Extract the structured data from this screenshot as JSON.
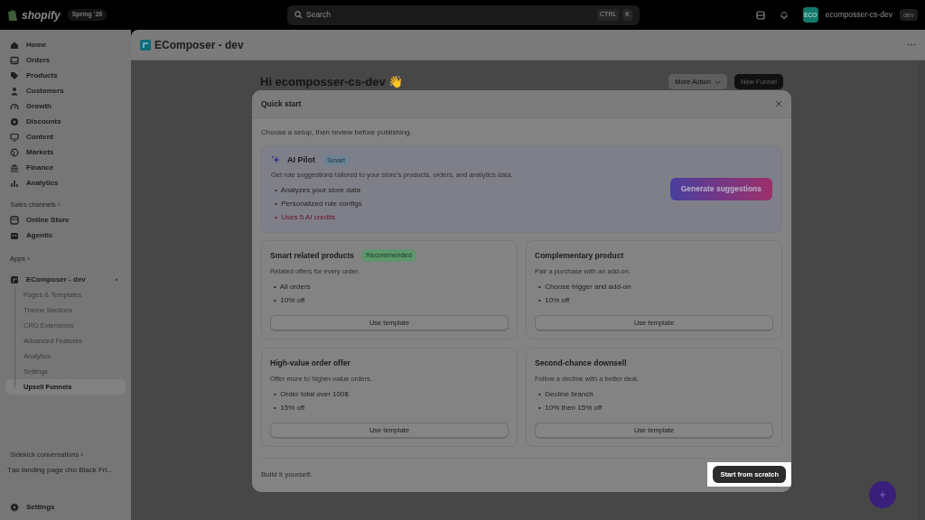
{
  "top_bar": {
    "brand": "shopify",
    "edition": "Spring '26",
    "search": {
      "placeholder": "Search",
      "shortcut": [
        "CTRL",
        "K"
      ]
    },
    "store": {
      "avatar": "ECO",
      "name": "ecomposser-cs-dev",
      "badge": "dev"
    }
  },
  "sidebar": {
    "nav": [
      {
        "label": "Home",
        "selected": false
      },
      {
        "label": "Orders",
        "selected": false
      },
      {
        "label": "Products",
        "selected": false
      },
      {
        "label": "Customers",
        "selected": false
      },
      {
        "label": "Growth",
        "selected": false
      },
      {
        "label": "Discounts",
        "selected": false
      },
      {
        "label": "Content",
        "selected": false
      },
      {
        "label": "Markets",
        "selected": false
      },
      {
        "label": "Finance",
        "selected": false
      },
      {
        "label": "Analytics",
        "selected": false
      }
    ],
    "sales_channels": {
      "title": "Sales channels ›",
      "items": [
        {
          "label": "Online Store",
          "selected": false
        },
        {
          "label": "Agentic",
          "selected": false
        }
      ]
    },
    "apps": {
      "title": "Apps ›",
      "app": {
        "label": "EComposer - dev",
        "children": [
          {
            "label": "Pages & Templates",
            "selected": false
          },
          {
            "label": "Theme Sections",
            "selected": false
          },
          {
            "label": "CRO Extensions",
            "selected": false
          },
          {
            "label": "Advanced Features",
            "selected": false
          },
          {
            "label": "Analytics",
            "selected": false
          },
          {
            "label": "Settings",
            "selected": false
          },
          {
            "label": "Upsell Funnels",
            "selected": true
          }
        ]
      }
    },
    "sidekick": {
      "title": "Sidekick conversations ›",
      "items": [
        "Tạo landing page cho Black Fri..."
      ]
    },
    "settings": "Settings"
  },
  "app_header": {
    "title": "EComposer - dev"
  },
  "page": {
    "greeting": "Hi ecomposser-cs-dev 👋",
    "actions": [
      {
        "label": "More Action",
        "kind": "menu"
      },
      {
        "label": "New Funnel",
        "kind": "primary"
      }
    ]
  },
  "modal": {
    "title": "Quick start",
    "bullet": "•",
    "intro": "Choose a setup, then review before publishing.",
    "ai_pilot": {
      "title": "AI Pilot",
      "badge": "Smart",
      "description": "Get rule suggestions tailored to your store's products, orders, and analytics data.",
      "bullets": [
        {
          "text": "Analyzes your store data",
          "kind": "normal"
        },
        {
          "text": "Personalized rule configs",
          "kind": "normal"
        },
        {
          "text": "Uses 5 AI credits",
          "kind": "warning"
        }
      ],
      "button": "Generate suggestions"
    },
    "templates": [
      {
        "title": "Smart related products",
        "badge": "Recommended",
        "description": "Related offers for every order.",
        "bullets": [
          "All orders",
          "10% off"
        ],
        "button": "Use template"
      },
      {
        "title": "Complementary product",
        "description": "Pair a purchase with an add-on.",
        "bullets": [
          "Choose trigger and add-on",
          "10% off"
        ],
        "button": "Use template"
      },
      {
        "title": "High-value order offer",
        "description": "Offer more to higher-value orders.",
        "bullets": [
          "Order total over 100$",
          "15% off"
        ],
        "button": "Use template"
      },
      {
        "title": "Second-chance downsell",
        "description": "Follow a decline with a better deal.",
        "bullets": [
          "Decline branch",
          "10% then 15% off"
        ],
        "button": "Use template"
      }
    ],
    "footer": {
      "text": "Build it yourself.",
      "button": "Start from scratch",
      "highlighted": true
    }
  }
}
